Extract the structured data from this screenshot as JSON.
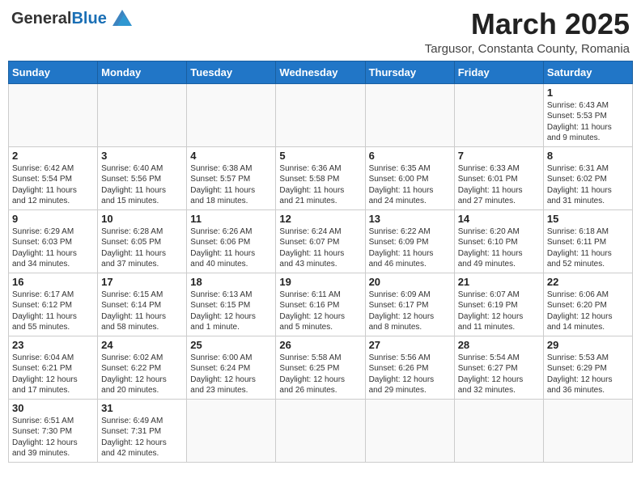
{
  "header": {
    "logo_general": "General",
    "logo_blue": "Blue",
    "month_title": "March 2025",
    "location": "Targusor, Constanta County, Romania"
  },
  "weekdays": [
    "Sunday",
    "Monday",
    "Tuesday",
    "Wednesday",
    "Thursday",
    "Friday",
    "Saturday"
  ],
  "weeks": [
    [
      {
        "day": "",
        "info": ""
      },
      {
        "day": "",
        "info": ""
      },
      {
        "day": "",
        "info": ""
      },
      {
        "day": "",
        "info": ""
      },
      {
        "day": "",
        "info": ""
      },
      {
        "day": "",
        "info": ""
      },
      {
        "day": "1",
        "info": "Sunrise: 6:43 AM\nSunset: 5:53 PM\nDaylight: 11 hours\nand 9 minutes."
      }
    ],
    [
      {
        "day": "2",
        "info": "Sunrise: 6:42 AM\nSunset: 5:54 PM\nDaylight: 11 hours\nand 12 minutes."
      },
      {
        "day": "3",
        "info": "Sunrise: 6:40 AM\nSunset: 5:56 PM\nDaylight: 11 hours\nand 15 minutes."
      },
      {
        "day": "4",
        "info": "Sunrise: 6:38 AM\nSunset: 5:57 PM\nDaylight: 11 hours\nand 18 minutes."
      },
      {
        "day": "5",
        "info": "Sunrise: 6:36 AM\nSunset: 5:58 PM\nDaylight: 11 hours\nand 21 minutes."
      },
      {
        "day": "6",
        "info": "Sunrise: 6:35 AM\nSunset: 6:00 PM\nDaylight: 11 hours\nand 24 minutes."
      },
      {
        "day": "7",
        "info": "Sunrise: 6:33 AM\nSunset: 6:01 PM\nDaylight: 11 hours\nand 27 minutes."
      },
      {
        "day": "8",
        "info": "Sunrise: 6:31 AM\nSunset: 6:02 PM\nDaylight: 11 hours\nand 31 minutes."
      }
    ],
    [
      {
        "day": "9",
        "info": "Sunrise: 6:29 AM\nSunset: 6:03 PM\nDaylight: 11 hours\nand 34 minutes."
      },
      {
        "day": "10",
        "info": "Sunrise: 6:28 AM\nSunset: 6:05 PM\nDaylight: 11 hours\nand 37 minutes."
      },
      {
        "day": "11",
        "info": "Sunrise: 6:26 AM\nSunset: 6:06 PM\nDaylight: 11 hours\nand 40 minutes."
      },
      {
        "day": "12",
        "info": "Sunrise: 6:24 AM\nSunset: 6:07 PM\nDaylight: 11 hours\nand 43 minutes."
      },
      {
        "day": "13",
        "info": "Sunrise: 6:22 AM\nSunset: 6:09 PM\nDaylight: 11 hours\nand 46 minutes."
      },
      {
        "day": "14",
        "info": "Sunrise: 6:20 AM\nSunset: 6:10 PM\nDaylight: 11 hours\nand 49 minutes."
      },
      {
        "day": "15",
        "info": "Sunrise: 6:18 AM\nSunset: 6:11 PM\nDaylight: 11 hours\nand 52 minutes."
      }
    ],
    [
      {
        "day": "16",
        "info": "Sunrise: 6:17 AM\nSunset: 6:12 PM\nDaylight: 11 hours\nand 55 minutes."
      },
      {
        "day": "17",
        "info": "Sunrise: 6:15 AM\nSunset: 6:14 PM\nDaylight: 11 hours\nand 58 minutes."
      },
      {
        "day": "18",
        "info": "Sunrise: 6:13 AM\nSunset: 6:15 PM\nDaylight: 12 hours\nand 1 minute."
      },
      {
        "day": "19",
        "info": "Sunrise: 6:11 AM\nSunset: 6:16 PM\nDaylight: 12 hours\nand 5 minutes."
      },
      {
        "day": "20",
        "info": "Sunrise: 6:09 AM\nSunset: 6:17 PM\nDaylight: 12 hours\nand 8 minutes."
      },
      {
        "day": "21",
        "info": "Sunrise: 6:07 AM\nSunset: 6:19 PM\nDaylight: 12 hours\nand 11 minutes."
      },
      {
        "day": "22",
        "info": "Sunrise: 6:06 AM\nSunset: 6:20 PM\nDaylight: 12 hours\nand 14 minutes."
      }
    ],
    [
      {
        "day": "23",
        "info": "Sunrise: 6:04 AM\nSunset: 6:21 PM\nDaylight: 12 hours\nand 17 minutes."
      },
      {
        "day": "24",
        "info": "Sunrise: 6:02 AM\nSunset: 6:22 PM\nDaylight: 12 hours\nand 20 minutes."
      },
      {
        "day": "25",
        "info": "Sunrise: 6:00 AM\nSunset: 6:24 PM\nDaylight: 12 hours\nand 23 minutes."
      },
      {
        "day": "26",
        "info": "Sunrise: 5:58 AM\nSunset: 6:25 PM\nDaylight: 12 hours\nand 26 minutes."
      },
      {
        "day": "27",
        "info": "Sunrise: 5:56 AM\nSunset: 6:26 PM\nDaylight: 12 hours\nand 29 minutes."
      },
      {
        "day": "28",
        "info": "Sunrise: 5:54 AM\nSunset: 6:27 PM\nDaylight: 12 hours\nand 32 minutes."
      },
      {
        "day": "29",
        "info": "Sunrise: 5:53 AM\nSunset: 6:29 PM\nDaylight: 12 hours\nand 36 minutes."
      }
    ],
    [
      {
        "day": "30",
        "info": "Sunrise: 6:51 AM\nSunset: 7:30 PM\nDaylight: 12 hours\nand 39 minutes."
      },
      {
        "day": "31",
        "info": "Sunrise: 6:49 AM\nSunset: 7:31 PM\nDaylight: 12 hours\nand 42 minutes."
      },
      {
        "day": "",
        "info": ""
      },
      {
        "day": "",
        "info": ""
      },
      {
        "day": "",
        "info": ""
      },
      {
        "day": "",
        "info": ""
      },
      {
        "day": "",
        "info": ""
      }
    ]
  ]
}
